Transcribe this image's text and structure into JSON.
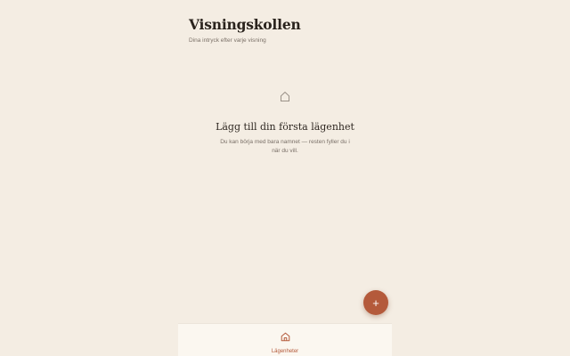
{
  "header": {
    "title": "Visningskollen",
    "subtitle": "Dina intryck efter varje visning"
  },
  "empty_state": {
    "icon": "house-icon",
    "title": "Lägg till din första lägenhet",
    "text": "Du kan börja med bara namnet — resten fyller du i när du vill."
  },
  "fab": {
    "icon": "plus",
    "label": "+"
  },
  "bottom_nav": {
    "items": [
      {
        "label": "Lägenheter",
        "icon": "home-icon",
        "active": true
      }
    ]
  },
  "colors": {
    "background": "#f4ede3",
    "accent": "#b45a3b",
    "nav_background": "#fbf7f0"
  }
}
